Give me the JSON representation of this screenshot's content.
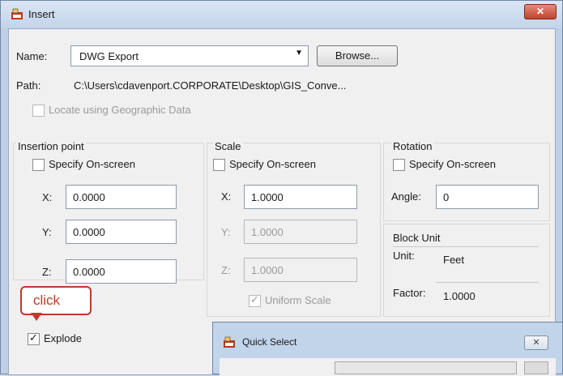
{
  "window": {
    "title": "Insert",
    "close_glyph": "✕"
  },
  "name": {
    "label": "Name:",
    "value": "DWG Export",
    "browse_label": "Browse..."
  },
  "path": {
    "label": "Path:",
    "value": "C:\\Users\\cdavenport.CORPORATE\\Desktop\\GIS_Conve..."
  },
  "locate": {
    "label": "Locate using Geographic Data"
  },
  "insertion": {
    "title": "Insertion point",
    "specify_label": "Specify On-screen",
    "x_label": "X:",
    "x_value": "0.0000",
    "y_label": "Y:",
    "y_value": "0.0000",
    "z_label": "Z:",
    "z_value": "0.0000"
  },
  "scale": {
    "title": "Scale",
    "specify_label": "Specify On-screen",
    "x_label": "X:",
    "x_value": "1.0000",
    "y_label": "Y:",
    "y_value": "1.0000",
    "z_label": "Z:",
    "z_value": "1.0000",
    "uniform_label": "Uniform Scale"
  },
  "rotation": {
    "title": "Rotation",
    "specify_label": "Specify On-screen",
    "angle_label": "Angle:",
    "angle_value": "0"
  },
  "block_unit": {
    "title": "Block Unit",
    "unit_label": "Unit:",
    "unit_value": "Feet",
    "factor_label": "Factor:",
    "factor_value": "1.0000"
  },
  "explode": {
    "label": "Explode",
    "checked": true
  },
  "callout": {
    "text": "click"
  },
  "quick_select": {
    "title": "Quick Select",
    "close_glyph": "✕"
  },
  "colors": {
    "callout": "#c0392b",
    "title_bar": "#c2d4ea",
    "close_button": "#c0432c"
  }
}
